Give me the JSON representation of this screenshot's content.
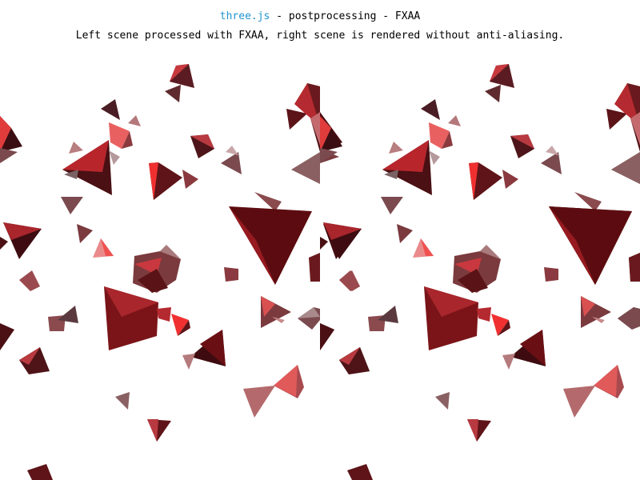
{
  "info": {
    "link_text": "three.js",
    "title_suffix": " - postprocessing - FXAA",
    "description": "Left scene processed with FXAA, right scene is rendered without anti-aliasing."
  },
  "colors": {
    "link": "#2194ce",
    "light_red": "#ef5350",
    "bright_red": "#e52b2b",
    "mid_red": "#b3262b",
    "dark_red": "#5a1014",
    "grey_red": "#7a4a4e",
    "pink": "#e07a7a"
  }
}
